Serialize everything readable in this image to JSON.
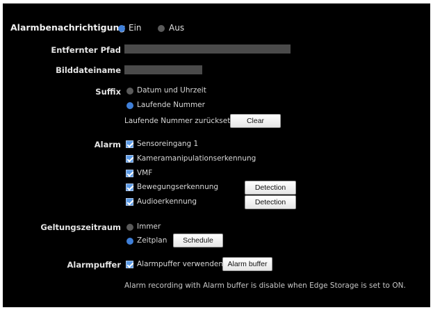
{
  "notification": {
    "label": "Alarmbenachrichtigung",
    "on_label": "Ein",
    "off_label": "Aus",
    "selected": "Ein"
  },
  "remote_path": {
    "label": "Entfernter Pfad",
    "value": ""
  },
  "image_filename": {
    "label": "Bilddateiname",
    "value": ""
  },
  "suffix": {
    "label": "Suffix",
    "option_datetime": "Datum und Uhrzeit",
    "option_sequence": "Laufende Nummer",
    "selected": "Laufende Nummer",
    "reset_label": "Laufende Nummer zurücksetzen",
    "clear_button": "Clear"
  },
  "alarm": {
    "label": "Alarm",
    "items": [
      {
        "label": "Sensoreingang 1",
        "checked": true
      },
      {
        "label": "Kameramanipulationserkennung",
        "checked": true
      },
      {
        "label": "VMF",
        "checked": true
      },
      {
        "label": "Bewegungserkennung",
        "checked": true,
        "button": "Detection"
      },
      {
        "label": "Audioerkennung",
        "checked": true,
        "button": "Detection"
      }
    ]
  },
  "validity": {
    "label": "Geltungszeitraum",
    "option_always": "Immer",
    "option_schedule": "Zeitplan",
    "selected": "Zeitplan",
    "schedule_button": "Schedule"
  },
  "alarm_buffer": {
    "label": "Alarmpuffer",
    "checkbox_label": "Alarmpuffer verwenden",
    "checked": true,
    "button": "Alarm buffer"
  },
  "note": "Alarm recording with Alarm buffer is disable when Edge Storage is set to ON.",
  "colors": {
    "panel_background": "#000000",
    "radio_selected": "#3f7fd8",
    "radio_unselected": "#5a5a5a",
    "checkbox": "#5c9be6",
    "field": "#4a4a4a"
  }
}
